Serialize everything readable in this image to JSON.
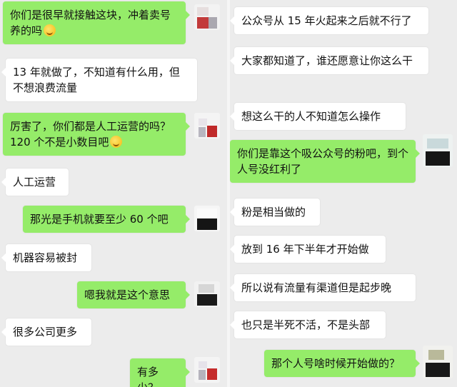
{
  "left_chat": {
    "messages": [
      {
        "text": "你们是很早就接触这块，冲着卖号养的吗",
        "emoji": "grinning-sweat-emoji"
      },
      {
        "text": "13 年就做了，不知道有什么用，但不想浪费流量"
      },
      {
        "text": "厉害了，你们都是人工运营的吗？120 个不是小数目吧",
        "emoji": "grinning-sweat-emoji"
      },
      {
        "text": "人工运营"
      },
      {
        "text": "那光是手机就要至少 60 个吧"
      },
      {
        "text": "机器容易被封"
      },
      {
        "text": "嗯我就是这个意思"
      },
      {
        "text": "很多公司更多"
      },
      {
        "text": "有多少？"
      }
    ]
  },
  "right_chat": {
    "messages": [
      {
        "text": "公众号从 15 年火起来之后就不行了"
      },
      {
        "text": "大家都知道了，谁还愿意让你这么干"
      },
      {
        "text": "想这么干的人不知道怎么操作"
      },
      {
        "text": "你们是靠这个吸公众号的粉吧，到个人号没红利了"
      },
      {
        "text": "粉是相当做的"
      },
      {
        "text": "放到 16 年下半年才开始做"
      },
      {
        "text": "所以说有流量有渠道但是起步晚"
      },
      {
        "text": "也只是半死不活，不是头部"
      },
      {
        "text": "那个人号啥时候开始做的？"
      }
    ]
  },
  "colors": {
    "incoming_bubble": "#ffffff",
    "outgoing_bubble": "#95ec69",
    "background": "#ececec"
  }
}
